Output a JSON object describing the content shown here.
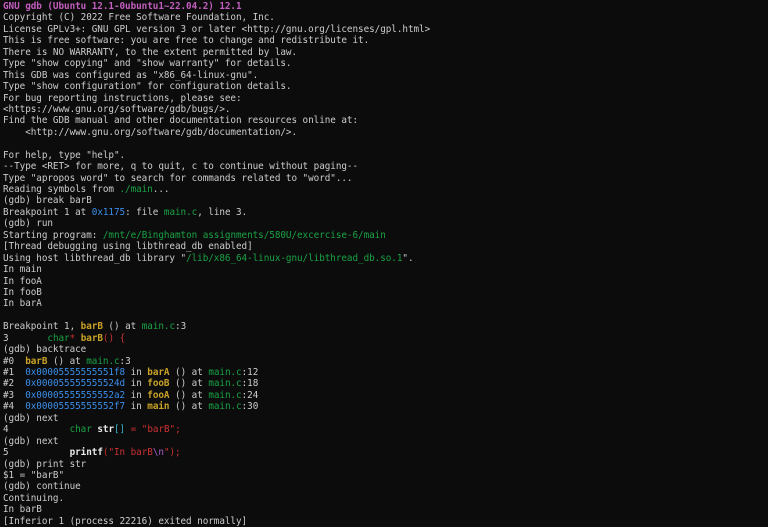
{
  "colors": {
    "background": "#0c0c0c",
    "foreground": "#cccccc",
    "magenta": "#c35dbf",
    "green": "#19a345",
    "blue": "#3b8eea",
    "yellow": "#c9a227",
    "red": "#cd3131",
    "purple": "#a25ec9",
    "cyan": "#33b3c4",
    "bold_white": "#e9e9e9"
  },
  "terminal": {
    "app": "gdb",
    "version_line": "GNU gdb (Ubuntu 12.1-0ubuntu1~22.04.2) 12.1",
    "prompt": "(gdb)",
    "breakpoint_address": "0x1175",
    "source_file": "main.c",
    "program_path": "/mnt/e/Binghamton assignments/580U/excercise-6/main",
    "process_id": "22216",
    "print_result": "$1 = \"barB\"",
    "backtrace_frames": [
      {
        "frame": "#0",
        "address": "",
        "function": "barB",
        "location": "main.c:3"
      },
      {
        "frame": "#1",
        "address": "0x00005555555551f8",
        "function": "barA",
        "location": "main.c:12"
      },
      {
        "frame": "#2",
        "address": "0x000055555555524d",
        "function": "fooB",
        "location": "main.c:18"
      },
      {
        "frame": "#3",
        "address": "0x00005555555552a2",
        "function": "fooA",
        "location": "main.c:24"
      },
      {
        "frame": "#4",
        "address": "0x00005555555552f7",
        "function": "main",
        "location": "main.c:30"
      }
    ],
    "lines": [
      [
        {
          "t": "GNU gdb (Ubuntu 12.1-0ubuntu1~22.04.2) 12.1",
          "s": "m"
        }
      ],
      [
        {
          "t": "Copyright (C) 2022 Free Software Foundation, Inc.",
          "s": "d"
        }
      ],
      [
        {
          "t": "License GPLv3+: GNU GPL version 3 or later <http://gnu.org/licenses/gpl.html>",
          "s": "d"
        }
      ],
      [
        {
          "t": "This is free software: you are free to change and redistribute it.",
          "s": "d"
        }
      ],
      [
        {
          "t": "There is NO WARRANTY, to the extent permitted by law.",
          "s": "d"
        }
      ],
      [
        {
          "t": "Type \"show copying\" and \"show warranty\" for details.",
          "s": "d"
        }
      ],
      [
        {
          "t": "This GDB was configured as \"x86_64-linux-gnu\".",
          "s": "d"
        }
      ],
      [
        {
          "t": "Type \"show configuration\" for configuration details.",
          "s": "d"
        }
      ],
      [
        {
          "t": "For bug reporting instructions, please see:",
          "s": "d"
        }
      ],
      [
        {
          "t": "<https://www.gnu.org/software/gdb/bugs/>.",
          "s": "d"
        }
      ],
      [
        {
          "t": "Find the GDB manual and other documentation resources online at:",
          "s": "d"
        }
      ],
      [
        {
          "t": "    <http://www.gnu.org/software/gdb/documentation/>.",
          "s": "d"
        }
      ],
      [],
      [
        {
          "t": "For help, type \"help\".",
          "s": "d"
        }
      ],
      [
        {
          "t": "--Type <RET> for more, q to quit, c to continue without paging--",
          "s": "d"
        }
      ],
      [
        {
          "t": "Type \"apropos word\" to search for commands related to \"word\"...",
          "s": "d"
        }
      ],
      [
        {
          "t": "Reading symbols from ",
          "s": "d"
        },
        {
          "t": "./main",
          "s": "g"
        },
        {
          "t": "...",
          "s": "d"
        }
      ],
      [
        {
          "t": "(gdb) break barB",
          "s": "d"
        }
      ],
      [
        {
          "t": "Breakpoint 1 at ",
          "s": "d"
        },
        {
          "t": "0x1175",
          "s": "b"
        },
        {
          "t": ": file ",
          "s": "d"
        },
        {
          "t": "main.c",
          "s": "g"
        },
        {
          "t": ", line 3.",
          "s": "d"
        }
      ],
      [
        {
          "t": "(gdb) run",
          "s": "d"
        }
      ],
      [
        {
          "t": "Starting program: ",
          "s": "d"
        },
        {
          "t": "/mnt/e/Binghamton assignments/580U/excercise-6/main",
          "s": "g"
        }
      ],
      [
        {
          "t": "[Thread debugging using libthread_db enabled]",
          "s": "d"
        }
      ],
      [
        {
          "t": "Using host libthread_db library \"",
          "s": "d"
        },
        {
          "t": "/lib/x86_64-linux-gnu/libthread_db.so.1",
          "s": "g"
        },
        {
          "t": "\".",
          "s": "d"
        }
      ],
      [
        {
          "t": "In main",
          "s": "d"
        }
      ],
      [
        {
          "t": "In fooA",
          "s": "d"
        }
      ],
      [
        {
          "t": "In fooB",
          "s": "d"
        }
      ],
      [
        {
          "t": "In barA",
          "s": "d"
        }
      ],
      [],
      [
        {
          "t": "Breakpoint 1, ",
          "s": "d"
        },
        {
          "t": "barB",
          "s": "y"
        },
        {
          "t": " () at ",
          "s": "d"
        },
        {
          "t": "main.c",
          "s": "g"
        },
        {
          "t": ":3",
          "s": "d"
        }
      ],
      [
        {
          "t": "3       ",
          "s": "d"
        },
        {
          "t": "char",
          "s": "g"
        },
        {
          "t": "*",
          "s": "r"
        },
        {
          "t": " ",
          "s": "d"
        },
        {
          "t": "barB",
          "s": "y"
        },
        {
          "t": "()",
          "s": "r"
        },
        {
          "t": " ",
          "s": "d"
        },
        {
          "t": "{",
          "s": "r"
        }
      ],
      [
        {
          "t": "(gdb) backtrace",
          "s": "d"
        }
      ],
      [
        {
          "t": "#0  ",
          "s": "d"
        },
        {
          "t": "barB",
          "s": "y"
        },
        {
          "t": " () at ",
          "s": "d"
        },
        {
          "t": "main.c",
          "s": "g"
        },
        {
          "t": ":3",
          "s": "d"
        }
      ],
      [
        {
          "t": "#1  ",
          "s": "d"
        },
        {
          "t": "0x00005555555551f8",
          "s": "b"
        },
        {
          "t": " in ",
          "s": "d"
        },
        {
          "t": "barA",
          "s": "y"
        },
        {
          "t": " () at ",
          "s": "d"
        },
        {
          "t": "main.c",
          "s": "g"
        },
        {
          "t": ":12",
          "s": "d"
        }
      ],
      [
        {
          "t": "#2  ",
          "s": "d"
        },
        {
          "t": "0x000055555555524d",
          "s": "b"
        },
        {
          "t": " in ",
          "s": "d"
        },
        {
          "t": "fooB",
          "s": "y"
        },
        {
          "t": " () at ",
          "s": "d"
        },
        {
          "t": "main.c",
          "s": "g"
        },
        {
          "t": ":18",
          "s": "d"
        }
      ],
      [
        {
          "t": "#3  ",
          "s": "d"
        },
        {
          "t": "0x00005555555552a2",
          "s": "b"
        },
        {
          "t": " in ",
          "s": "d"
        },
        {
          "t": "fooA",
          "s": "y"
        },
        {
          "t": " () at ",
          "s": "d"
        },
        {
          "t": "main.c",
          "s": "g"
        },
        {
          "t": ":24",
          "s": "d"
        }
      ],
      [
        {
          "t": "#4  ",
          "s": "d"
        },
        {
          "t": "0x00005555555552f7",
          "s": "b"
        },
        {
          "t": " in ",
          "s": "d"
        },
        {
          "t": "main",
          "s": "y"
        },
        {
          "t": " () at ",
          "s": "d"
        },
        {
          "t": "main.c",
          "s": "g"
        },
        {
          "t": ":30",
          "s": "d"
        }
      ],
      [
        {
          "t": "(gdb) next",
          "s": "d"
        }
      ],
      [
        {
          "t": "4           ",
          "s": "d"
        },
        {
          "t": "char",
          "s": "g"
        },
        {
          "t": " ",
          "s": "d"
        },
        {
          "t": "str",
          "s": "w"
        },
        {
          "t": "[]",
          "s": "c"
        },
        {
          "t": " ",
          "s": "d"
        },
        {
          "t": "=",
          "s": "r"
        },
        {
          "t": " ",
          "s": "d"
        },
        {
          "t": "\"barB\"",
          "s": "r"
        },
        {
          "t": ";",
          "s": "r"
        }
      ],
      [
        {
          "t": "(gdb) next",
          "s": "d"
        }
      ],
      [
        {
          "t": "5           ",
          "s": "d"
        },
        {
          "t": "printf",
          "s": "w"
        },
        {
          "t": "(",
          "s": "r"
        },
        {
          "t": "\"In barB",
          "s": "r"
        },
        {
          "t": "\\n",
          "s": "p"
        },
        {
          "t": "\"",
          "s": "r"
        },
        {
          "t": ");",
          "s": "r"
        }
      ],
      [
        {
          "t": "(gdb) print str",
          "s": "d"
        }
      ],
      [
        {
          "t": "$1 = \"barB\"",
          "s": "d"
        }
      ],
      [
        {
          "t": "(gdb) continue",
          "s": "d"
        }
      ],
      [
        {
          "t": "Continuing.",
          "s": "d"
        }
      ],
      [
        {
          "t": "In barB",
          "s": "d"
        }
      ],
      [
        {
          "t": "[Inferior 1 (process 22216) exited normally]",
          "s": "d"
        }
      ]
    ]
  }
}
